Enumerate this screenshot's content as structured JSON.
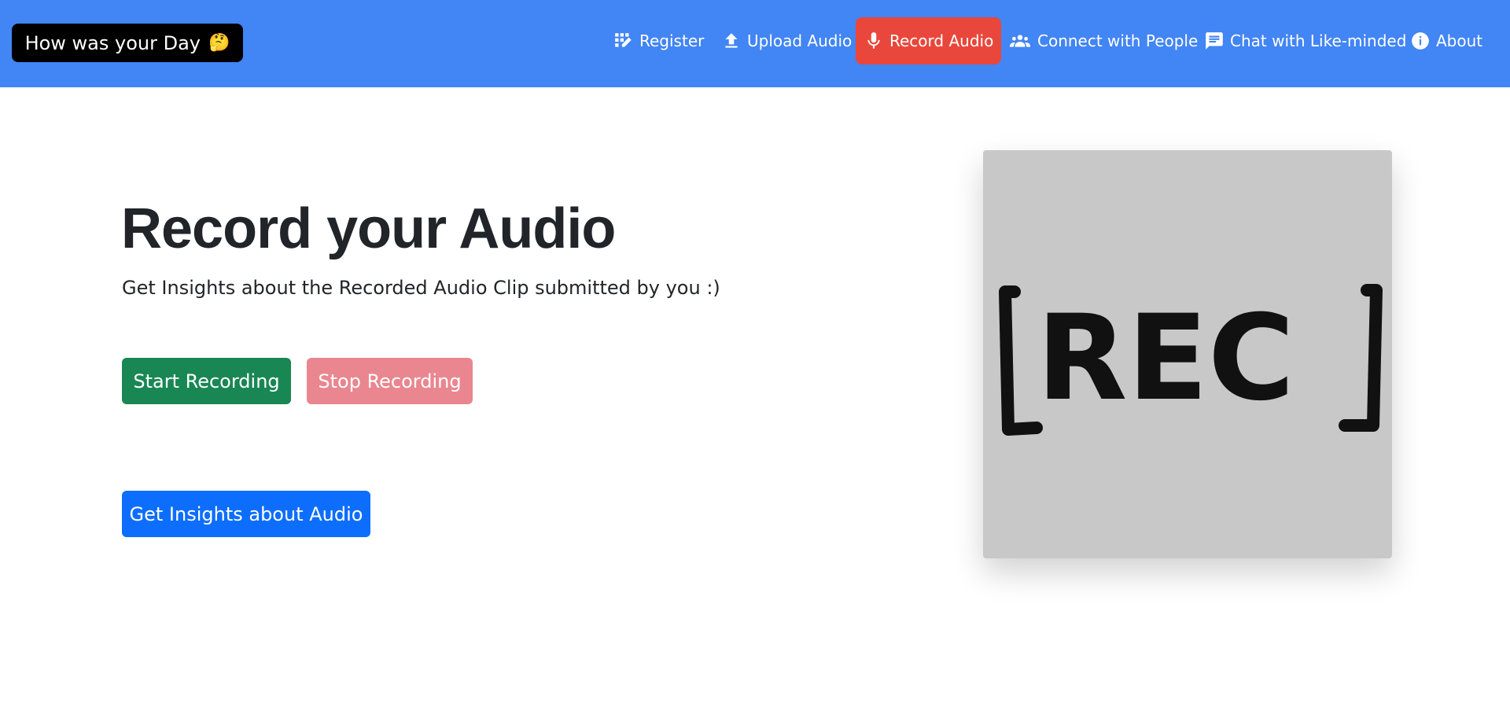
{
  "brand": {
    "title": "How was your Day",
    "emoji": "🤔"
  },
  "nav": {
    "items": [
      {
        "label": "Register",
        "icon": "register-icon"
      },
      {
        "label": "Upload Audio",
        "icon": "upload-icon"
      },
      {
        "label": "Record Audio",
        "icon": "microphone-icon",
        "active": true
      },
      {
        "label": "Connect with People",
        "icon": "people-icon"
      },
      {
        "label": "Chat with Like-minded",
        "icon": "chat-icon"
      },
      {
        "label": "About",
        "icon": "info-icon"
      }
    ]
  },
  "main": {
    "title": "Record your Audio",
    "subtitle": "Get Insights about the Recorded Audio Clip submitted by you :)",
    "start_label": "Start Recording",
    "stop_label": "Stop Recording",
    "insights_label": "Get Insights about Audio"
  },
  "illustration": {
    "text": "REC"
  },
  "colors": {
    "navbar": "#4285f4",
    "active_nav": "#e9473b",
    "start": "#198754",
    "stop": "#ea868f",
    "insights": "#0d6efd"
  }
}
